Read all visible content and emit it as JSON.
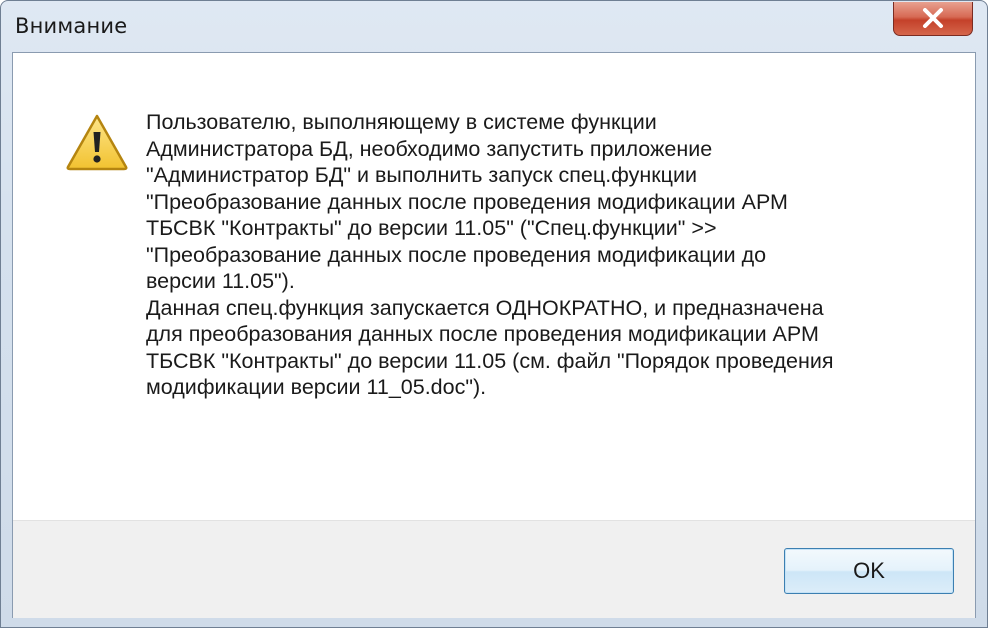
{
  "dialog": {
    "title": "Внимание",
    "icon": "warning-icon",
    "message": "Пользователю, выполняющему в системе функции\nАдминистратора БД, необходимо запустить приложение\n\"Администратор БД\" и выполнить запуск спец.функции\n\"Преобразование данных после проведения модификации АРМ\nТБСВК \"Контракты\" до версии 11.05\" (\"Спец.функции\" >>\n\"Преобразование данных после проведения модификации до\nверсии 11.05\").\nДанная спец.функция запускается ОДНОКРАТНО, и предназначена\nдля преобразования данных после проведения модификации АРМ\nТБСВК \"Контракты\" до версии 11.05 (см. файл \"Порядок проведения\nмодификации версии 11_05.doc\").",
    "ok_label": "OK",
    "close_icon": "close-icon"
  },
  "colors": {
    "close_button": "#c4412a",
    "warning_fill": "#f2c230",
    "ok_border": "#3c7fb1"
  }
}
